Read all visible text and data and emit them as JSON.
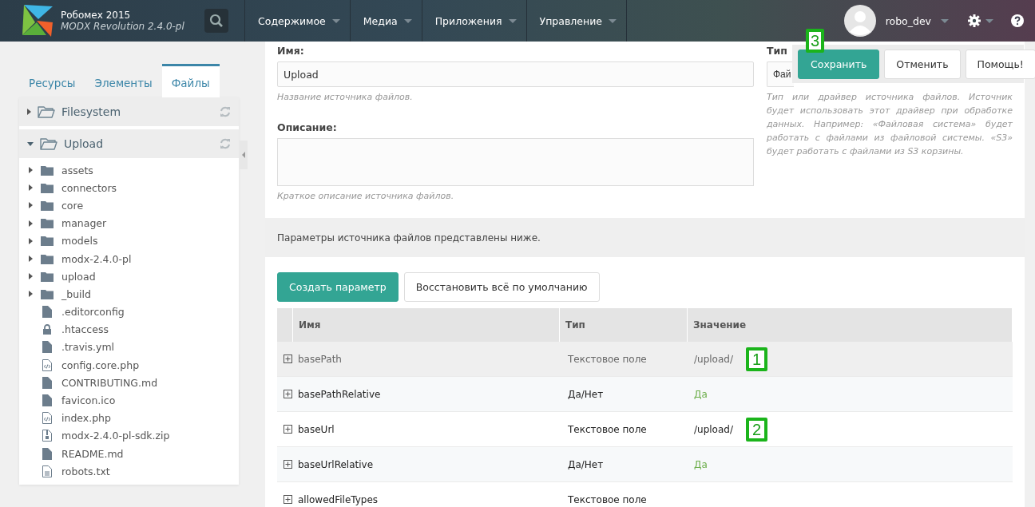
{
  "header": {
    "site_name": "Робомех 2015",
    "version": "MODX Revolution 2.4.0-pl",
    "menu": [
      {
        "label": "Содержимое"
      },
      {
        "label": "Медиа"
      },
      {
        "label": "Приложения"
      },
      {
        "label": "Управление"
      }
    ],
    "username": "robo_dev"
  },
  "sidebar": {
    "tabs": [
      {
        "label": "Ресурсы",
        "selected": false
      },
      {
        "label": "Элементы",
        "selected": false
      },
      {
        "label": "Файлы",
        "selected": true
      }
    ],
    "sources": [
      {
        "label": "Filesystem",
        "expanded": false
      },
      {
        "label": "Upload",
        "expanded": true,
        "children": [
          {
            "label": "assets",
            "kind": "folder"
          },
          {
            "label": "connectors",
            "kind": "folder"
          },
          {
            "label": "core",
            "kind": "folder"
          },
          {
            "label": "manager",
            "kind": "folder"
          },
          {
            "label": "models",
            "kind": "folder"
          },
          {
            "label": "modx-2.4.0-pl",
            "kind": "folder"
          },
          {
            "label": "upload",
            "kind": "folder"
          },
          {
            "label": "_build",
            "kind": "folder"
          },
          {
            "label": ".editorconfig",
            "kind": "file"
          },
          {
            "label": ".htaccess",
            "kind": "lock"
          },
          {
            "label": ".travis.yml",
            "kind": "file"
          },
          {
            "label": "config.core.php",
            "kind": "code"
          },
          {
            "label": "CONTRIBUTING.md",
            "kind": "file"
          },
          {
            "label": "favicon.ico",
            "kind": "file"
          },
          {
            "label": "index.php",
            "kind": "code"
          },
          {
            "label": "modx-2.4.0-pl-sdk.zip",
            "kind": "zip"
          },
          {
            "label": "README.md",
            "kind": "file"
          },
          {
            "label": "robots.txt",
            "kind": "text"
          }
        ]
      }
    ]
  },
  "form": {
    "name_label": "Имя:",
    "name_value": "Upload",
    "name_hint": "Название источника файлов.",
    "description_label": "Описание:",
    "description_hint": "Краткое описание источника файлов.",
    "type_label": "Тип",
    "type_value": "Фай",
    "type_hint": "Тип или драйвер источника файлов. Источник будет использовать этот драйвер при обработке данных. Например: «Файловая система» будет работать с файлами из файловой системы. «S3» будет работать с файлами из S3 корзины."
  },
  "actions": [
    "Сохранить",
    "Отменить",
    "Помощь!"
  ],
  "params_note": "Параметры источника файлов представлены ниже.",
  "params_buttons": [
    "Создать параметр",
    "Восстановить всё по умолчанию"
  ],
  "table": {
    "columns": [
      "Имя",
      "Тип",
      "Значение"
    ],
    "rows": [
      {
        "name": "basePath",
        "type": "Текстовое поле",
        "value": "/upload/",
        "kind": "text",
        "selected": true
      },
      {
        "name": "basePathRelative",
        "type": "Да/Нет",
        "value": "Да",
        "kind": "boolean",
        "selected": false
      },
      {
        "name": "baseUrl",
        "type": "Текстовое поле",
        "value": "/upload/",
        "kind": "text",
        "selected": false
      },
      {
        "name": "baseUrlRelative",
        "type": "Да/Нет",
        "value": "Да",
        "kind": "boolean",
        "selected": false
      },
      {
        "name": "allowedFileTypes",
        "type": "Текстовое поле",
        "selected": false
      }
    ]
  },
  "markers": [
    "1",
    "2",
    "3"
  ]
}
